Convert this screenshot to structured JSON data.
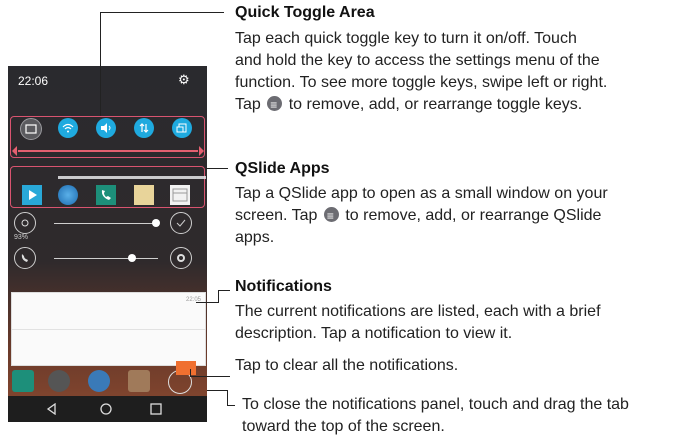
{
  "phone": {
    "status_time": "22:06",
    "gear_icon": "gear-icon",
    "battery_text": "93%",
    "notification_time": "22:05",
    "nav_icons": [
      "back-icon",
      "home-icon",
      "recents-icon"
    ]
  },
  "callouts": {
    "quick_toggle": {
      "title": "Quick Toggle Area",
      "lines": [
        "Tap each quick toggle key to turn it on/off. Touch",
        "and hold the key to access the settings menu of the",
        "function. To see more toggle keys, swipe left or right.",
        "Tap",
        " to remove, add, or rearrange toggle keys."
      ]
    },
    "qslide": {
      "title": "QSlide Apps",
      "lines": [
        "Tap a QSlide app to open as a small window on your",
        "screen. Tap",
        " to remove, add, or rearrange QSlide",
        "apps."
      ]
    },
    "notifications": {
      "title": "Notifications",
      "lines": [
        "The current notifications are listed, each with a brief",
        "description. Tap a notification to view it."
      ]
    },
    "clear": {
      "text": "Tap to clear all the notifications."
    },
    "close": {
      "lines": [
        "To close the notifications panel, touch and drag the tab",
        "toward the top of the screen."
      ]
    }
  },
  "colors": {
    "highlight": "#d95470",
    "toggle_on": "#1faadf"
  }
}
